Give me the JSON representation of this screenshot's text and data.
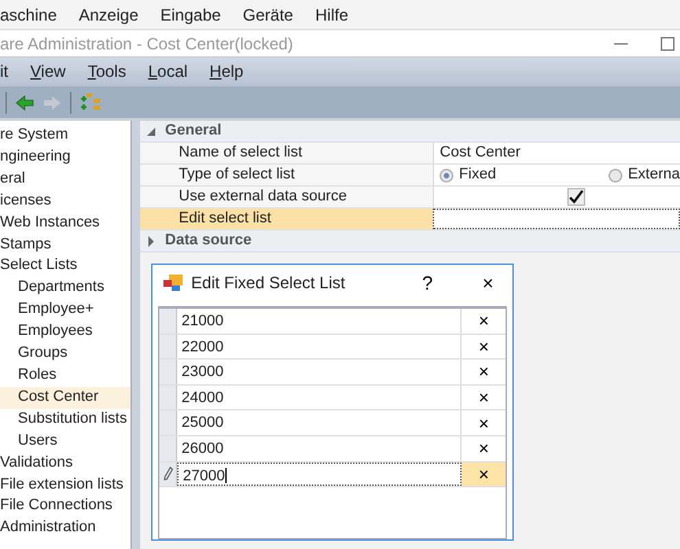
{
  "host_menu": [
    "aschine",
    "Anzeige",
    "Eingabe",
    "Geräte",
    "Hilfe"
  ],
  "window": {
    "title": "are Administration - Cost Center(locked)"
  },
  "menu": [
    {
      "label": "it",
      "mnemonic": false
    },
    {
      "label": "View",
      "mnemonic": true
    },
    {
      "label": "Tools",
      "mnemonic": true
    },
    {
      "label": "Local",
      "mnemonic": true
    },
    {
      "label": "Help",
      "mnemonic": true
    }
  ],
  "tree": [
    {
      "label": "re System",
      "selected": false
    },
    {
      "label": "ngineering",
      "selected": false
    },
    {
      "label": "eral",
      "selected": false
    },
    {
      "label": "icenses",
      "selected": false
    },
    {
      "label": "Web Instances",
      "selected": false
    },
    {
      "label": "Stamps",
      "selected": false
    },
    {
      "label": "Select Lists",
      "selected": false,
      "children": [
        {
          "label": "Departments",
          "selected": false
        },
        {
          "label": "Employee+",
          "selected": false
        },
        {
          "label": "Employees",
          "selected": false
        },
        {
          "label": "Groups",
          "selected": false
        },
        {
          "label": "Roles",
          "selected": false
        },
        {
          "label": "Cost Center",
          "selected": true
        },
        {
          "label": "Substitution lists",
          "selected": false
        },
        {
          "label": "Users",
          "selected": false
        }
      ]
    },
    {
      "label": "Validations",
      "selected": false
    },
    {
      "label": "File extension lists",
      "selected": false
    },
    {
      "label": "File Connections",
      "selected": false
    },
    {
      "label": "Administration",
      "selected": false
    }
  ],
  "properties": [
    {
      "name": "General",
      "expanded": true,
      "rows": [
        {
          "label": "Name of select list",
          "kind": "text",
          "value": "Cost Center",
          "selected": false
        },
        {
          "label": "Type of select list",
          "kind": "radio",
          "options": [
            {
              "label": "Fixed",
              "selected": true
            },
            {
              "label": "Externa",
              "selected": false
            }
          ],
          "selected": false
        },
        {
          "label": "Use external data source",
          "kind": "check",
          "checked": true,
          "selected": false
        },
        {
          "label": "Edit select list",
          "kind": "button",
          "selected": true
        }
      ]
    },
    {
      "name": "Data source",
      "expanded": false
    }
  ],
  "dialog": {
    "title": "Edit Fixed Select List",
    "help": "?",
    "close": "×",
    "rows": [
      {
        "value": "21000",
        "delete": "×",
        "editing": false
      },
      {
        "value": "22000",
        "delete": "×",
        "editing": false
      },
      {
        "value": "23000",
        "delete": "×",
        "editing": false
      },
      {
        "value": "24000",
        "delete": "×",
        "editing": false
      },
      {
        "value": "25000",
        "delete": "×",
        "editing": false
      },
      {
        "value": "26000",
        "delete": "×",
        "editing": false
      },
      {
        "value": "27000",
        "delete": "×",
        "editing": true
      }
    ]
  }
}
